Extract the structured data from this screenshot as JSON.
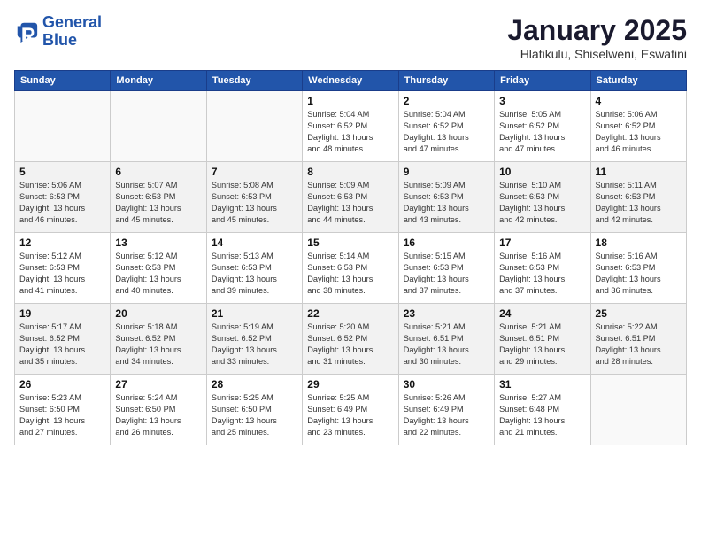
{
  "header": {
    "logo_line1": "General",
    "logo_line2": "Blue",
    "title": "January 2025",
    "subtitle": "Hlatikulu, Shiselweni, Eswatini"
  },
  "weekdays": [
    "Sunday",
    "Monday",
    "Tuesday",
    "Wednesday",
    "Thursday",
    "Friday",
    "Saturday"
  ],
  "weeks": [
    [
      {
        "day": "",
        "info": ""
      },
      {
        "day": "",
        "info": ""
      },
      {
        "day": "",
        "info": ""
      },
      {
        "day": "1",
        "info": "Sunrise: 5:04 AM\nSunset: 6:52 PM\nDaylight: 13 hours\nand 48 minutes."
      },
      {
        "day": "2",
        "info": "Sunrise: 5:04 AM\nSunset: 6:52 PM\nDaylight: 13 hours\nand 47 minutes."
      },
      {
        "day": "3",
        "info": "Sunrise: 5:05 AM\nSunset: 6:52 PM\nDaylight: 13 hours\nand 47 minutes."
      },
      {
        "day": "4",
        "info": "Sunrise: 5:06 AM\nSunset: 6:52 PM\nDaylight: 13 hours\nand 46 minutes."
      }
    ],
    [
      {
        "day": "5",
        "info": "Sunrise: 5:06 AM\nSunset: 6:53 PM\nDaylight: 13 hours\nand 46 minutes."
      },
      {
        "day": "6",
        "info": "Sunrise: 5:07 AM\nSunset: 6:53 PM\nDaylight: 13 hours\nand 45 minutes."
      },
      {
        "day": "7",
        "info": "Sunrise: 5:08 AM\nSunset: 6:53 PM\nDaylight: 13 hours\nand 45 minutes."
      },
      {
        "day": "8",
        "info": "Sunrise: 5:09 AM\nSunset: 6:53 PM\nDaylight: 13 hours\nand 44 minutes."
      },
      {
        "day": "9",
        "info": "Sunrise: 5:09 AM\nSunset: 6:53 PM\nDaylight: 13 hours\nand 43 minutes."
      },
      {
        "day": "10",
        "info": "Sunrise: 5:10 AM\nSunset: 6:53 PM\nDaylight: 13 hours\nand 42 minutes."
      },
      {
        "day": "11",
        "info": "Sunrise: 5:11 AM\nSunset: 6:53 PM\nDaylight: 13 hours\nand 42 minutes."
      }
    ],
    [
      {
        "day": "12",
        "info": "Sunrise: 5:12 AM\nSunset: 6:53 PM\nDaylight: 13 hours\nand 41 minutes."
      },
      {
        "day": "13",
        "info": "Sunrise: 5:12 AM\nSunset: 6:53 PM\nDaylight: 13 hours\nand 40 minutes."
      },
      {
        "day": "14",
        "info": "Sunrise: 5:13 AM\nSunset: 6:53 PM\nDaylight: 13 hours\nand 39 minutes."
      },
      {
        "day": "15",
        "info": "Sunrise: 5:14 AM\nSunset: 6:53 PM\nDaylight: 13 hours\nand 38 minutes."
      },
      {
        "day": "16",
        "info": "Sunrise: 5:15 AM\nSunset: 6:53 PM\nDaylight: 13 hours\nand 37 minutes."
      },
      {
        "day": "17",
        "info": "Sunrise: 5:16 AM\nSunset: 6:53 PM\nDaylight: 13 hours\nand 37 minutes."
      },
      {
        "day": "18",
        "info": "Sunrise: 5:16 AM\nSunset: 6:53 PM\nDaylight: 13 hours\nand 36 minutes."
      }
    ],
    [
      {
        "day": "19",
        "info": "Sunrise: 5:17 AM\nSunset: 6:52 PM\nDaylight: 13 hours\nand 35 minutes."
      },
      {
        "day": "20",
        "info": "Sunrise: 5:18 AM\nSunset: 6:52 PM\nDaylight: 13 hours\nand 34 minutes."
      },
      {
        "day": "21",
        "info": "Sunrise: 5:19 AM\nSunset: 6:52 PM\nDaylight: 13 hours\nand 33 minutes."
      },
      {
        "day": "22",
        "info": "Sunrise: 5:20 AM\nSunset: 6:52 PM\nDaylight: 13 hours\nand 31 minutes."
      },
      {
        "day": "23",
        "info": "Sunrise: 5:21 AM\nSunset: 6:51 PM\nDaylight: 13 hours\nand 30 minutes."
      },
      {
        "day": "24",
        "info": "Sunrise: 5:21 AM\nSunset: 6:51 PM\nDaylight: 13 hours\nand 29 minutes."
      },
      {
        "day": "25",
        "info": "Sunrise: 5:22 AM\nSunset: 6:51 PM\nDaylight: 13 hours\nand 28 minutes."
      }
    ],
    [
      {
        "day": "26",
        "info": "Sunrise: 5:23 AM\nSunset: 6:50 PM\nDaylight: 13 hours\nand 27 minutes."
      },
      {
        "day": "27",
        "info": "Sunrise: 5:24 AM\nSunset: 6:50 PM\nDaylight: 13 hours\nand 26 minutes."
      },
      {
        "day": "28",
        "info": "Sunrise: 5:25 AM\nSunset: 6:50 PM\nDaylight: 13 hours\nand 25 minutes."
      },
      {
        "day": "29",
        "info": "Sunrise: 5:25 AM\nSunset: 6:49 PM\nDaylight: 13 hours\nand 23 minutes."
      },
      {
        "day": "30",
        "info": "Sunrise: 5:26 AM\nSunset: 6:49 PM\nDaylight: 13 hours\nand 22 minutes."
      },
      {
        "day": "31",
        "info": "Sunrise: 5:27 AM\nSunset: 6:48 PM\nDaylight: 13 hours\nand 21 minutes."
      },
      {
        "day": "",
        "info": ""
      }
    ]
  ]
}
